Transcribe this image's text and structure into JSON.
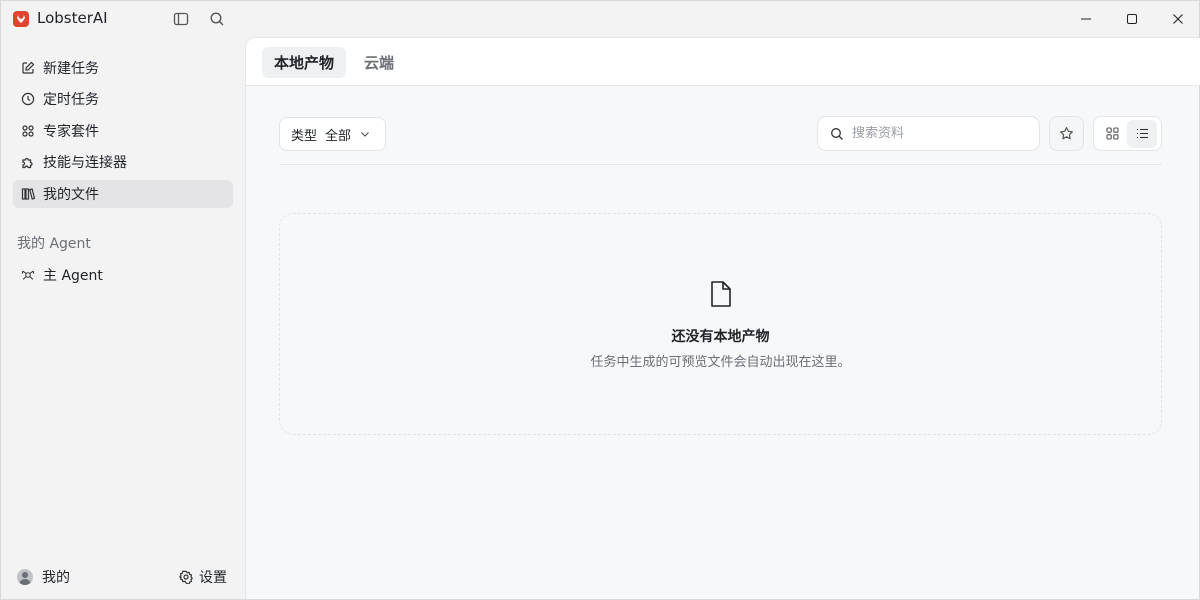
{
  "app": {
    "title": "LobsterAI",
    "logo_icon": "lobster-logo-icon",
    "brand_color": "#e0442f"
  },
  "titlebar": {
    "sidebar_toggle_icon": "sidebar-toggle-icon",
    "search_icon": "search-icon",
    "controls": [
      "minimize",
      "maximize",
      "close"
    ]
  },
  "sidebar": {
    "items": [
      {
        "label": "新建任务",
        "icon": "edit-icon"
      },
      {
        "label": "定时任务",
        "icon": "clock-icon"
      },
      {
        "label": "专家套件",
        "icon": "grid-dots-icon"
      },
      {
        "label": "技能与连接器",
        "icon": "puzzle-icon"
      },
      {
        "label": "我的文件",
        "icon": "books-icon",
        "active": true
      }
    ],
    "section_label": "我的 Agent",
    "agents": [
      {
        "label": "主 Agent",
        "icon": "agent-icon"
      }
    ],
    "footer": {
      "user_label": "我的",
      "settings_label": "设置"
    }
  },
  "main": {
    "tabs": [
      {
        "label": "本地产物",
        "active": true
      },
      {
        "label": "云端",
        "active": false
      }
    ],
    "filter": {
      "label": "类型",
      "value": "全部"
    },
    "search": {
      "placeholder": "搜索资料",
      "value": ""
    },
    "view_mode": "list",
    "empty": {
      "title": "还没有本地产物",
      "subtitle": "任务中生成的可预览文件会自动出现在这里。"
    }
  }
}
